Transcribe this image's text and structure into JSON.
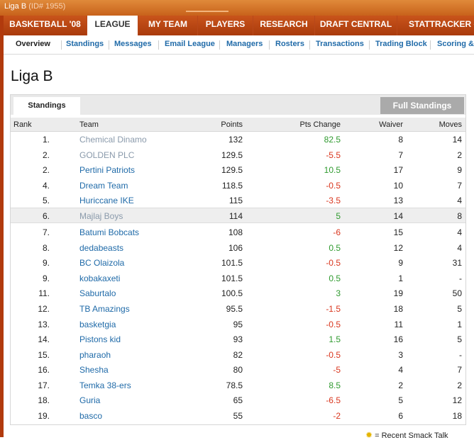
{
  "window": {
    "league_name": "Liga B",
    "league_id": "(ID# 1955)"
  },
  "mainnav": [
    {
      "label": "BASKETBALL '08",
      "active": false
    },
    {
      "label": "LEAGUE",
      "active": true
    },
    {
      "label": "MY TEAM",
      "active": false
    },
    {
      "label": "PLAYERS",
      "active": false
    },
    {
      "label": "RESEARCH",
      "active": false
    },
    {
      "label": "DRAFT CENTRAL",
      "active": false
    },
    {
      "label": "STATTRACKER",
      "active": false,
      "external_icon": "external-link-icon"
    }
  ],
  "subnav": [
    {
      "label": "Overview",
      "active": true
    },
    {
      "label": "Standings"
    },
    {
      "label": "Messages"
    },
    {
      "label": "Email League"
    },
    {
      "label": "Managers"
    },
    {
      "label": "Rosters"
    },
    {
      "label": "Transactions"
    },
    {
      "label": "Trading Block"
    },
    {
      "label": "Scoring &"
    }
  ],
  "page": {
    "title": "Liga B"
  },
  "standings": {
    "tab_label": "Standings",
    "full_button": "Full Standings",
    "headers": {
      "rank": "Rank",
      "team": "Team",
      "points": "Points",
      "change": "Pts Change",
      "waiver": "Waiver",
      "moves": "Moves"
    },
    "rows": [
      {
        "rank": "1.",
        "team": "Chemical Dinamo",
        "points": "132",
        "change": "82.5",
        "waiver": "8",
        "moves": "14"
      },
      {
        "rank": "2.",
        "team": "GOLDEN PLC",
        "points": "129.5",
        "change": "-5.5",
        "waiver": "7",
        "moves": "2"
      },
      {
        "rank": "2.",
        "team": "Pertini Patriots",
        "points": "129.5",
        "change": "10.5",
        "waiver": "17",
        "moves": "9"
      },
      {
        "rank": "4.",
        "team": "Dream Team",
        "points": "118.5",
        "change": "-0.5",
        "waiver": "10",
        "moves": "7"
      },
      {
        "rank": "5.",
        "team": "Huriccane IKE",
        "points": "115",
        "change": "-3.5",
        "waiver": "13",
        "moves": "4"
      },
      {
        "rank": "6.",
        "team": "Majlaj Boys",
        "points": "114",
        "change": "5",
        "waiver": "14",
        "moves": "8"
      },
      {
        "rank": "7.",
        "team": "Batumi Bobcats",
        "points": "108",
        "change": "-6",
        "waiver": "15",
        "moves": "4"
      },
      {
        "rank": "8.",
        "team": "dedabeasts",
        "points": "106",
        "change": "0.5",
        "waiver": "12",
        "moves": "4"
      },
      {
        "rank": "9.",
        "team": "BC Olaizola",
        "points": "101.5",
        "change": "-0.5",
        "waiver": "9",
        "moves": "31"
      },
      {
        "rank": "9.",
        "team": "kobakaxeti",
        "points": "101.5",
        "change": "0.5",
        "waiver": "1",
        "moves": "-"
      },
      {
        "rank": "11.",
        "team": "Saburtalo",
        "points": "100.5",
        "change": "3",
        "waiver": "19",
        "moves": "50"
      },
      {
        "rank": "12.",
        "team": "TB Amazings",
        "points": "95.5",
        "change": "-1.5",
        "waiver": "18",
        "moves": "5"
      },
      {
        "rank": "13.",
        "team": "basketgia",
        "points": "95",
        "change": "-0.5",
        "waiver": "11",
        "moves": "1"
      },
      {
        "rank": "14.",
        "team": "Pistons kid",
        "points": "93",
        "change": "1.5",
        "waiver": "16",
        "moves": "5"
      },
      {
        "rank": "15.",
        "team": "pharaoh",
        "points": "82",
        "change": "-0.5",
        "waiver": "3",
        "moves": "-"
      },
      {
        "rank": "16.",
        "team": "Shesha",
        "points": "80",
        "change": "-5",
        "waiver": "4",
        "moves": "7"
      },
      {
        "rank": "17.",
        "team": "Temka 38-ers",
        "points": "78.5",
        "change": "8.5",
        "waiver": "2",
        "moves": "2"
      },
      {
        "rank": "18.",
        "team": "Guria",
        "points": "65",
        "change": "-6.5",
        "waiver": "5",
        "moves": "12"
      },
      {
        "rank": "19.",
        "team": "basco",
        "points": "55",
        "change": "-2",
        "waiver": "6",
        "moves": "18"
      }
    ]
  },
  "legend": {
    "icon": "star-icon",
    "text": "= Recent Smack Talk"
  },
  "colors": {
    "nav_bg": "#b8461a",
    "link": "#1f6aa8",
    "positive": "#2f9a2f",
    "negative": "#d9361e"
  }
}
